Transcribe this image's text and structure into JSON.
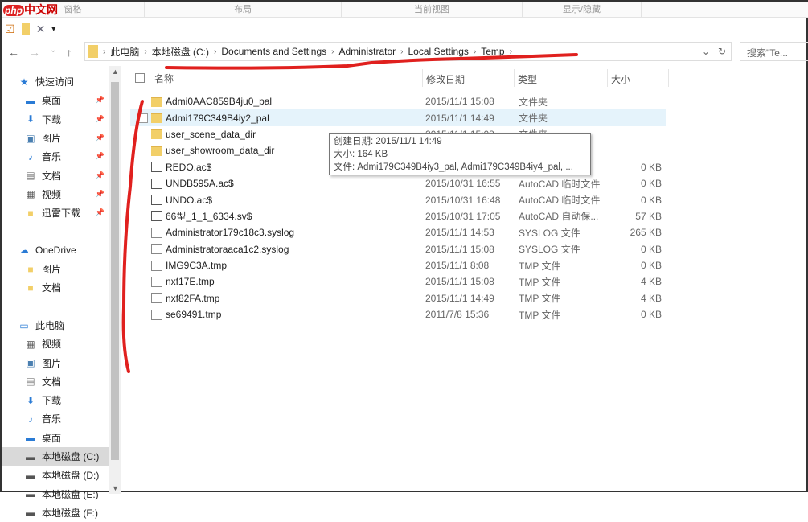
{
  "watermark": {
    "php": "php",
    "text": "中文网"
  },
  "ribbon": [
    "窗格",
    "布局",
    "当前视图",
    "显示/隐藏"
  ],
  "nav": {
    "back": "←",
    "forward": "→",
    "recent": "⌄",
    "up": "↑"
  },
  "breadcrumb": [
    "此电脑",
    "本地磁盘 (C:)",
    "Documents and Settings",
    "Administrator",
    "Local Settings",
    "Temp"
  ],
  "search_placeholder": "搜索\"Te...",
  "columns": {
    "name": "名称",
    "date": "修改日期",
    "type": "类型",
    "size": "大小"
  },
  "sidebar": [
    {
      "label": "快速访问",
      "icon": "star",
      "head": true
    },
    {
      "label": "桌面",
      "icon": "desktop",
      "pin": true
    },
    {
      "label": "下载",
      "icon": "download",
      "pin": true
    },
    {
      "label": "图片",
      "icon": "picture",
      "pin": true
    },
    {
      "label": "音乐",
      "icon": "music",
      "pin": true
    },
    {
      "label": "文档",
      "icon": "document",
      "pin": true
    },
    {
      "label": "视频",
      "icon": "video",
      "pin": true
    },
    {
      "label": "迅雷下载",
      "icon": "folder",
      "pin": true
    },
    {
      "label": "",
      "icon": "",
      "spacer": true
    },
    {
      "label": "OneDrive",
      "icon": "cloud",
      "head": true
    },
    {
      "label": "图片",
      "icon": "folder"
    },
    {
      "label": "文档",
      "icon": "folder"
    },
    {
      "label": "",
      "icon": "",
      "spacer": true
    },
    {
      "label": "此电脑",
      "icon": "computer",
      "head": true
    },
    {
      "label": "视频",
      "icon": "video"
    },
    {
      "label": "图片",
      "icon": "picture"
    },
    {
      "label": "文档",
      "icon": "document"
    },
    {
      "label": "下载",
      "icon": "download"
    },
    {
      "label": "音乐",
      "icon": "music"
    },
    {
      "label": "桌面",
      "icon": "desktop"
    },
    {
      "label": "本地磁盘 (C:)",
      "icon": "drive",
      "selected": true
    },
    {
      "label": "本地磁盘 (D:)",
      "icon": "drive"
    },
    {
      "label": "本地磁盘 (E:)",
      "icon": "drive"
    },
    {
      "label": "本地磁盘 (F:)",
      "icon": "drive"
    }
  ],
  "files": [
    {
      "name": "Admi0AAC859B4ju0_pal",
      "date": "2015/11/1 15:08",
      "type": "文件夹",
      "size": "",
      "icon": "folder"
    },
    {
      "name": "Admi179C349B4iy2_pal",
      "date": "2015/11/1 14:49",
      "type": "文件夹",
      "size": "",
      "icon": "folder",
      "hover": true
    },
    {
      "name": "user_scene_data_dir",
      "date": "2015/11/1 15:08",
      "type": "文件夹",
      "size": "",
      "icon": "folder"
    },
    {
      "name": "user_showroom_data_dir",
      "date": "",
      "type": "",
      "size": "",
      "icon": "folder"
    },
    {
      "name": "REDO.ac$",
      "date": "",
      "type": "文件",
      "size": "0 KB",
      "icon": "cad"
    },
    {
      "name": "UNDB595A.ac$",
      "date": "2015/10/31 16:55",
      "type": "AutoCAD 临时文件",
      "size": "0 KB",
      "icon": "cad"
    },
    {
      "name": "UNDO.ac$",
      "date": "2015/10/31 16:48",
      "type": "AutoCAD 临时文件",
      "size": "0 KB",
      "icon": "cad"
    },
    {
      "name": "66型_1_1_6334.sv$",
      "date": "2015/10/31 17:05",
      "type": "AutoCAD 自动保...",
      "size": "57 KB",
      "icon": "cad"
    },
    {
      "name": "Administrator179c18c3.syslog",
      "date": "2015/11/1 14:53",
      "type": "SYSLOG 文件",
      "size": "265 KB",
      "icon": "file"
    },
    {
      "name": "Administratoraaca1c2.syslog",
      "date": "2015/11/1 15:08",
      "type": "SYSLOG 文件",
      "size": "0 KB",
      "icon": "file"
    },
    {
      "name": "IMG9C3A.tmp",
      "date": "2015/11/1 8:08",
      "type": "TMP 文件",
      "size": "0 KB",
      "icon": "file"
    },
    {
      "name": "nxf17E.tmp",
      "date": "2015/11/1 15:08",
      "type": "TMP 文件",
      "size": "4 KB",
      "icon": "file"
    },
    {
      "name": "nxf82FA.tmp",
      "date": "2015/11/1 14:49",
      "type": "TMP 文件",
      "size": "4 KB",
      "icon": "file"
    },
    {
      "name": "se69491.tmp",
      "date": "2011/7/8 15:36",
      "type": "TMP 文件",
      "size": "0 KB",
      "icon": "file"
    }
  ],
  "tooltip": {
    "created": "创建日期: 2015/11/1 14:49",
    "size": "大小: 164 KB",
    "files": "文件: Admi179C349B4iy3_pal, Admi179C349B4iy4_pal, ..."
  }
}
